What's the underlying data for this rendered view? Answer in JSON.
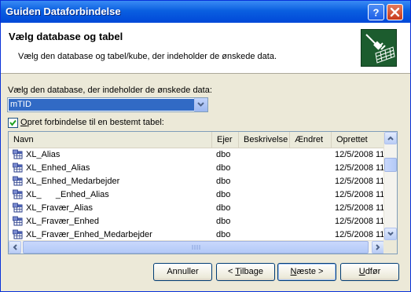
{
  "window": {
    "title": "Guiden Dataforbindelse"
  },
  "header": {
    "title": "Vælg database og tabel",
    "subtitle": "Vælg den database og tabel/kube, der indeholder de ønskede data.",
    "icon": "data-connection-icon"
  },
  "database": {
    "label": "Vælg den database, der indeholder de ønskede data:",
    "selected": "mTID"
  },
  "checkbox": {
    "checked": true,
    "label_pre": "",
    "label_acc": "O",
    "label_rest": "pret forbindelse til en bestemt tabel:"
  },
  "table": {
    "columns": {
      "name": "Navn",
      "owner": "Ejer",
      "description": "Beskrivelse",
      "modified": "Ændret",
      "created": "Oprettet"
    },
    "rows": [
      {
        "name": "XL_Alias",
        "owner": "dbo",
        "description": "",
        "modified": "",
        "created": "12/5/2008 11"
      },
      {
        "name": "XL_Enhed_Alias",
        "owner": "dbo",
        "description": "",
        "modified": "",
        "created": "12/5/2008 11"
      },
      {
        "name": "XL_Enhed_Medarbejder",
        "owner": "dbo",
        "description": "",
        "modified": "",
        "created": "12/5/2008 11"
      },
      {
        "name": "XL_      _Enhed_Alias",
        "owner": "dbo",
        "description": "",
        "modified": "",
        "created": "12/5/2008 11"
      },
      {
        "name": "XL_Fravær_Alias",
        "owner": "dbo",
        "description": "",
        "modified": "",
        "created": "12/5/2008 11"
      },
      {
        "name": "XL_Fravær_Enhed",
        "owner": "dbo",
        "description": "",
        "modified": "",
        "created": "12/5/2008 11"
      },
      {
        "name": "XL_Fravær_Enhed_Medarbejder",
        "owner": "dbo",
        "description": "",
        "modified": "",
        "created": "12/5/2008 11"
      }
    ]
  },
  "buttons": {
    "cancel": {
      "label": "Annuller"
    },
    "back": {
      "pre": "< ",
      "acc": "T",
      "rest": "ilbage"
    },
    "next": {
      "pre": "",
      "acc": "N",
      "rest": "æste >"
    },
    "finish": {
      "pre": "",
      "acc": "U",
      "rest": "dfør"
    }
  },
  "colors": {
    "titlebar": "#0a5fe0",
    "selection": "#316ac5",
    "header_icon_bg": "#1c5c2e"
  }
}
